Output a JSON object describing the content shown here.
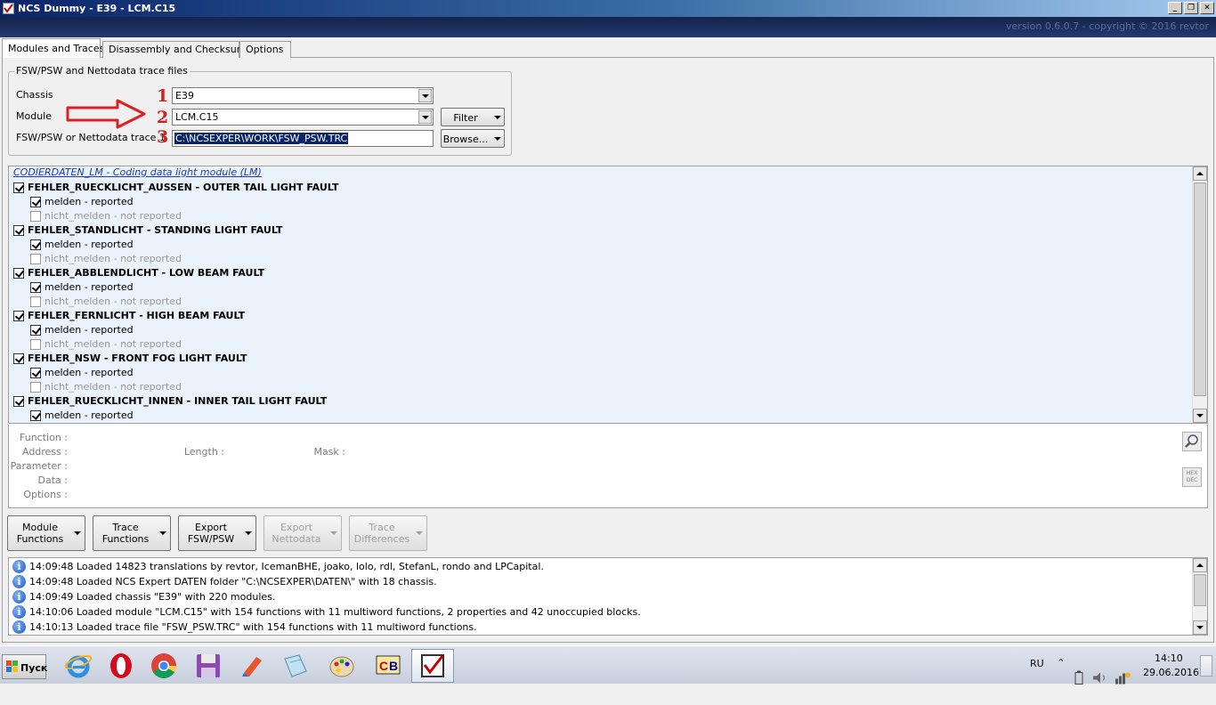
{
  "window": {
    "title": "NCS Dummy - E39 - LCM.C15",
    "version": "version 0.6.0.7 - copyright © 2016 revtor"
  },
  "tabs": [
    {
      "label": "Modules and Traces",
      "active": true
    },
    {
      "label": "Disassembly and Checksums",
      "active": false
    },
    {
      "label": "Options",
      "active": false
    }
  ],
  "trace_files": {
    "group_title": "FSW/PSW and Nettodata trace files",
    "chassis_label": "Chassis",
    "chassis_value": "E39",
    "module_label": "Module",
    "module_value": "LCM.C15",
    "trace_label": "FSW/PSW or Nettodata trace 1",
    "trace_value": "C:\\NCSEXPER\\WORK\\FSW_PSW.TRC",
    "filter_label": "Filter",
    "browse_label": "Browse...",
    "annotations": [
      "1",
      "2",
      "3"
    ],
    "annotation_color": "#d12020"
  },
  "tree": {
    "header": "CODIERDATEN_LM  -  Coding data light module (LM)",
    "functions": [
      {
        "name": "FEHLER_RUECKLICHT_AUSSEN  -  OUTER TAIL LIGHT FAULT",
        "checked": true,
        "options": [
          {
            "label": "melden  -  reported",
            "checked": true
          },
          {
            "label": "nicht_melden  -  not reported",
            "checked": false
          }
        ]
      },
      {
        "name": "FEHLER_STANDLICHT  -  STANDING LIGHT FAULT",
        "checked": true,
        "options": [
          {
            "label": "melden  -  reported",
            "checked": true
          },
          {
            "label": "nicht_melden  -  not reported",
            "checked": false
          }
        ]
      },
      {
        "name": "FEHLER_ABBLENDLICHT  -  LOW BEAM FAULT",
        "checked": true,
        "options": [
          {
            "label": "melden  -  reported",
            "checked": true
          },
          {
            "label": "nicht_melden  -  not reported",
            "checked": false
          }
        ]
      },
      {
        "name": "FEHLER_FERNLICHT  -  HIGH BEAM FAULT",
        "checked": true,
        "options": [
          {
            "label": "melden  -  reported",
            "checked": true
          },
          {
            "label": "nicht_melden  -  not reported",
            "checked": false
          }
        ]
      },
      {
        "name": "FEHLER_NSW  -  FRONT FOG LIGHT FAULT",
        "checked": true,
        "options": [
          {
            "label": "melden  -  reported",
            "checked": true
          },
          {
            "label": "nicht_melden  -  not reported",
            "checked": false
          }
        ]
      },
      {
        "name": "FEHLER_RUECKLICHT_INNEN  -  INNER TAIL LIGHT FAULT",
        "checked": true,
        "options": [
          {
            "label": "melden  -  reported",
            "checked": true
          }
        ]
      }
    ]
  },
  "details": {
    "function_label": "Function :",
    "address_label": "Address :",
    "parameter_label": "Parameter :",
    "data_label": "Data :",
    "options_label": "Options :",
    "length_label": "Length :",
    "mask_label": "Mask :",
    "hexdec_label_1": "HEX",
    "hexdec_label_2": "DEC"
  },
  "actions": [
    {
      "line1": "Module",
      "line2": "Functions",
      "enabled": true
    },
    {
      "line1": "Trace",
      "line2": "Functions",
      "enabled": true
    },
    {
      "line1": "Export",
      "line2": "FSW/PSW",
      "enabled": true
    },
    {
      "line1": "Export",
      "line2": "Nettodata",
      "enabled": false
    },
    {
      "line1": "Trace",
      "line2": "Differences",
      "enabled": false
    }
  ],
  "log": [
    {
      "time": "14:09:48",
      "text": "Loaded 14823 translations by revtor, IcemanBHE, joako, lolo, rdl, StefanL, rondo and LPCapital."
    },
    {
      "time": "14:09:48",
      "text": "Loaded NCS Expert DATEN folder \"C:\\NCSEXPER\\DATEN\\\" with 18 chassis."
    },
    {
      "time": "14:09:49",
      "text": "Loaded chassis \"E39\" with 220 modules."
    },
    {
      "time": "14:10:06",
      "text": "Loaded module \"LCM.C15\" with 154 functions with 11 multiword functions, 2 properties and 42 unoccupied blocks."
    },
    {
      "time": "14:10:13",
      "text": "Loaded trace file \"FSW_PSW.TRC\" with 154 functions with 11 multiword functions."
    }
  ],
  "taskbar": {
    "start_label": "Пуск",
    "icons": [
      "ie-icon",
      "opera-icon",
      "chrome-icon",
      "floppy-icon",
      "ccleaner-icon",
      "notepad-icon",
      "paint-icon",
      "cb-icon",
      "ncs-dummy-icon"
    ],
    "language": "RU",
    "time": "14:10",
    "date": "29.06.2016"
  }
}
